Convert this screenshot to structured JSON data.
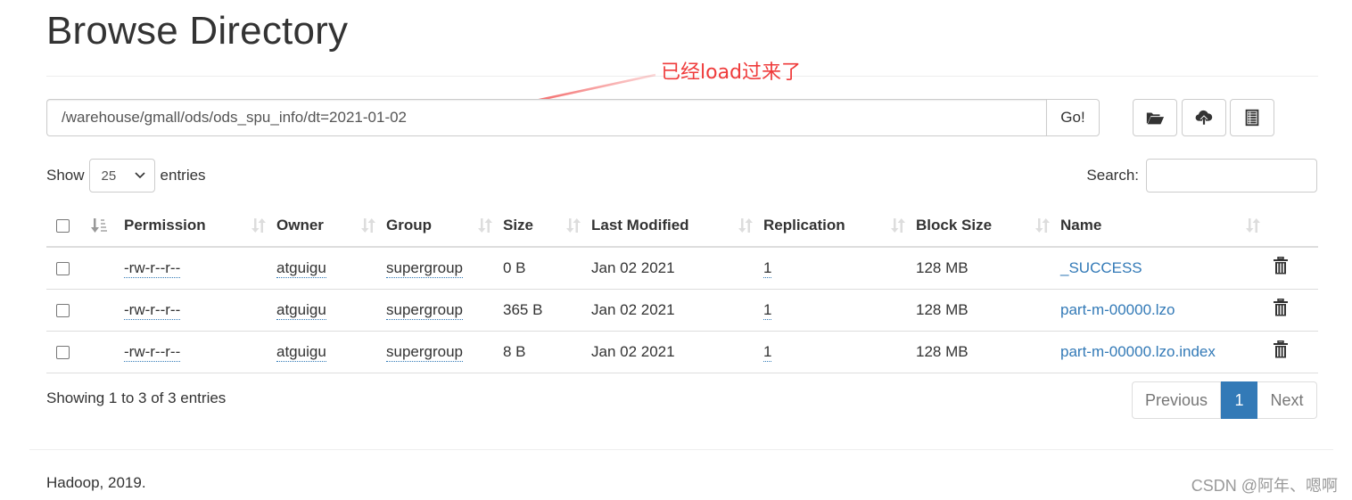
{
  "page": {
    "title": "Browse Directory"
  },
  "path_bar": {
    "value": "/warehouse/gmall/ods/ods_spu_info/dt=2021-01-02",
    "go_label": "Go!"
  },
  "toolbar": {
    "buttons": [
      {
        "icon": "folder-open-icon",
        "label": "Create directory"
      },
      {
        "icon": "cloud-upload-icon",
        "label": "Upload files"
      },
      {
        "icon": "list-icon",
        "label": "Cut & paste"
      }
    ]
  },
  "table_controls": {
    "show_label": "Show",
    "entries_label": "entries",
    "page_size": "25",
    "search_label": "Search:",
    "search_value": ""
  },
  "table": {
    "columns": [
      "Permission",
      "Owner",
      "Group",
      "Size",
      "Last Modified",
      "Replication",
      "Block Size",
      "Name"
    ],
    "rows": [
      {
        "permission": "-rw-r--r--",
        "owner": "atguigu",
        "group": "supergroup",
        "size": "0 B",
        "last_modified": "Jan 02 2021",
        "replication": "1",
        "block_size": "128 MB",
        "name": "_SUCCESS"
      },
      {
        "permission": "-rw-r--r--",
        "owner": "atguigu",
        "group": "supergroup",
        "size": "365 B",
        "last_modified": "Jan 02 2021",
        "replication": "1",
        "block_size": "128 MB",
        "name": "part-m-00000.lzo"
      },
      {
        "permission": "-rw-r--r--",
        "owner": "atguigu",
        "group": "supergroup",
        "size": "8 B",
        "last_modified": "Jan 02 2021",
        "replication": "1",
        "block_size": "128 MB",
        "name": "part-m-00000.lzo.index"
      }
    ]
  },
  "info": "Showing 1 to 3 of 3 entries",
  "pagination": {
    "previous": "Previous",
    "current": "1",
    "next": "Next"
  },
  "footer": "Hadoop, 2019.",
  "annotation": {
    "text": "已经load过来了",
    "color": "#ef3b3b"
  },
  "watermark": "CSDN @阿年、嗯啊",
  "colors": {
    "link": "#337ab7",
    "active_page": "#337ab7"
  }
}
